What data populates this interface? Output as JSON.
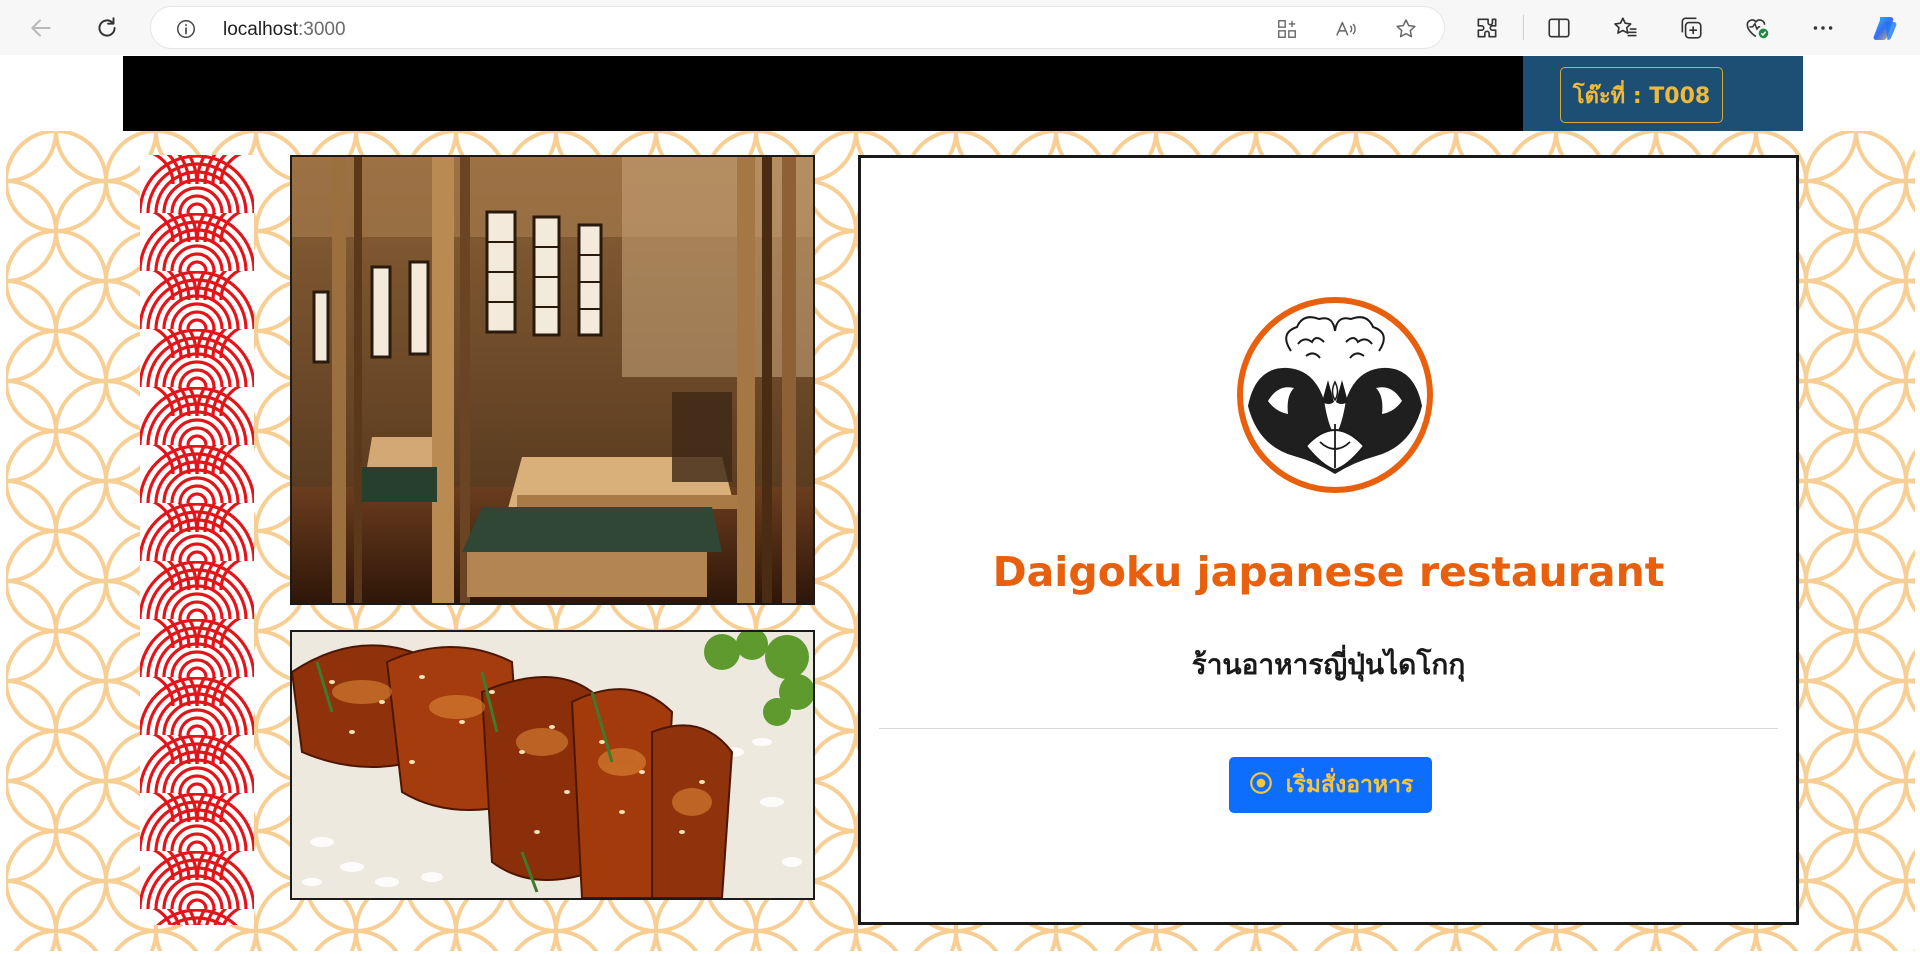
{
  "browser": {
    "url_host": "localhost",
    "url_port": ":3000"
  },
  "navbar": {
    "table_label": "โต๊ะที่ : T008"
  },
  "card": {
    "title": "Daigoku japanese restaurant",
    "subtitle": "ร้านอาหารญี่ปุ่นไดโกกุ",
    "order_button_label": "เริ่มสั่งอาหาร"
  },
  "colors": {
    "accent_orange": "#e8600d",
    "button_blue": "#0d6efd",
    "badge_gold": "#f1b93a",
    "navbar_blue": "#1c4f73",
    "pattern_peach": "#f7cf94",
    "wave_red": "#e3151b"
  },
  "icons": [
    "back-icon",
    "reload-icon",
    "info-icon",
    "app-available-icon",
    "read-aloud-icon",
    "favorite-star-icon",
    "extensions-icon",
    "split-screen-icon",
    "favorites-icon",
    "collections-icon",
    "browser-essentials-icon",
    "more-icon",
    "copilot-icon",
    "order-icon"
  ]
}
